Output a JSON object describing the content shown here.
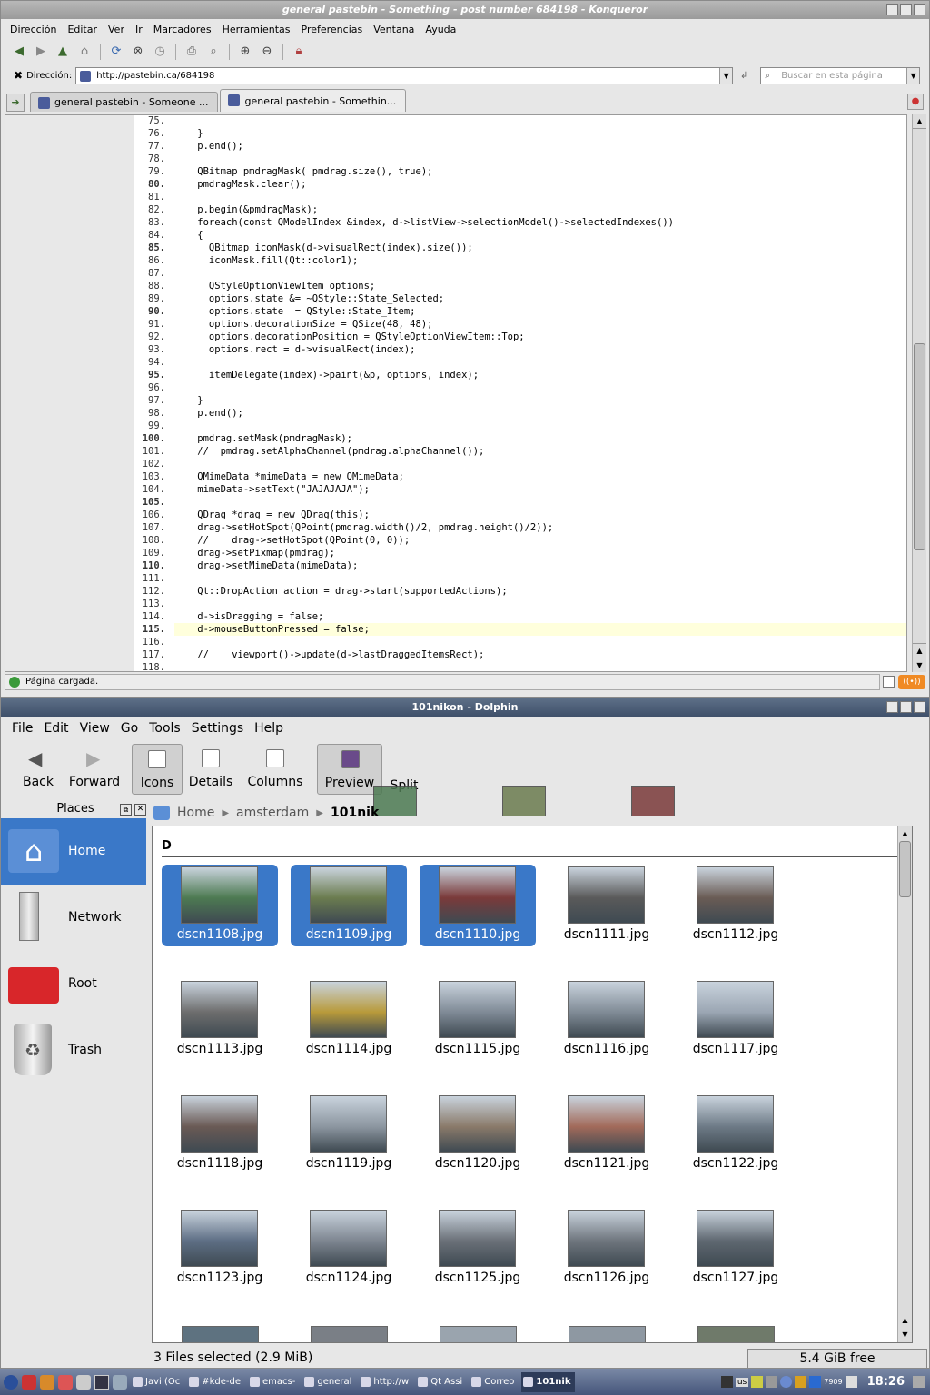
{
  "konqueror": {
    "title": "general pastebin - Something - post number 684198 - Konqueror",
    "menu": [
      "Dirección",
      "Editar",
      "Ver",
      "Ir",
      "Marcadores",
      "Herramientas",
      "Preferencias",
      "Ventana",
      "Ayuda"
    ],
    "address_label": "Dirección:",
    "address": "http://pastebin.ca/684198",
    "search_placeholder": "Buscar en esta página",
    "tabs": [
      {
        "label": "general pastebin - Someone ..."
      },
      {
        "label": "general pastebin - Somethin..."
      }
    ],
    "status": "Página cargada.",
    "code_lines": [
      {
        "n": "75.",
        "t": "",
        "b": false
      },
      {
        "n": "76.",
        "t": "    }",
        "b": false
      },
      {
        "n": "77.",
        "t": "    p.end();",
        "b": false
      },
      {
        "n": "78.",
        "t": "",
        "b": false
      },
      {
        "n": "79.",
        "t": "    QBitmap pmdragMask( pmdrag.size(), true);",
        "b": false
      },
      {
        "n": "80.",
        "t": "    pmdragMask.clear();",
        "b": true
      },
      {
        "n": "81.",
        "t": "",
        "b": false
      },
      {
        "n": "82.",
        "t": "    p.begin(&pmdragMask);",
        "b": false
      },
      {
        "n": "83.",
        "t": "    foreach(const QModelIndex &index, d->listView->selectionModel()->selectedIndexes())",
        "b": false
      },
      {
        "n": "84.",
        "t": "    {",
        "b": false
      },
      {
        "n": "85.",
        "t": "      QBitmap iconMask(d->visualRect(index).size());",
        "b": true
      },
      {
        "n": "86.",
        "t": "      iconMask.fill(Qt::color1);",
        "b": false
      },
      {
        "n": "87.",
        "t": "",
        "b": false
      },
      {
        "n": "88.",
        "t": "      QStyleOptionViewItem options;",
        "b": false
      },
      {
        "n": "89.",
        "t": "      options.state &= ~QStyle::State_Selected;",
        "b": false
      },
      {
        "n": "90.",
        "t": "      options.state |= QStyle::State_Item;",
        "b": true
      },
      {
        "n": "91.",
        "t": "      options.decorationSize = QSize(48, 48);",
        "b": false
      },
      {
        "n": "92.",
        "t": "      options.decorationPosition = QStyleOptionViewItem::Top;",
        "b": false
      },
      {
        "n": "93.",
        "t": "      options.rect = d->visualRect(index);",
        "b": false
      },
      {
        "n": "94.",
        "t": "",
        "b": false
      },
      {
        "n": "95.",
        "t": "      itemDelegate(index)->paint(&p, options, index);",
        "b": true
      },
      {
        "n": "96.",
        "t": "",
        "b": false
      },
      {
        "n": "97.",
        "t": "    }",
        "b": false
      },
      {
        "n": "98.",
        "t": "    p.end();",
        "b": false
      },
      {
        "n": "99.",
        "t": "",
        "b": false
      },
      {
        "n": "100.",
        "t": "    pmdrag.setMask(pmdragMask);",
        "b": true
      },
      {
        "n": "101.",
        "t": "    //  pmdrag.setAlphaChannel(pmdrag.alphaChannel());",
        "b": false
      },
      {
        "n": "102.",
        "t": "",
        "b": false
      },
      {
        "n": "103.",
        "t": "    QMimeData *mimeData = new QMimeData;",
        "b": false
      },
      {
        "n": "104.",
        "t": "    mimeData->setText(\"JAJAJAJA\");",
        "b": false
      },
      {
        "n": "105.",
        "t": "",
        "b": true
      },
      {
        "n": "106.",
        "t": "    QDrag *drag = new QDrag(this);",
        "b": false
      },
      {
        "n": "107.",
        "t": "    drag->setHotSpot(QPoint(pmdrag.width()/2, pmdrag.height()/2));",
        "b": false
      },
      {
        "n": "108.",
        "t": "    //    drag->setHotSpot(QPoint(0, 0));",
        "b": false
      },
      {
        "n": "109.",
        "t": "    drag->setPixmap(pmdrag);",
        "b": false
      },
      {
        "n": "110.",
        "t": "    drag->setMimeData(mimeData);",
        "b": true
      },
      {
        "n": "111.",
        "t": "",
        "b": false
      },
      {
        "n": "112.",
        "t": "    Qt::DropAction action = drag->start(supportedActions);",
        "b": false
      },
      {
        "n": "113.",
        "t": "",
        "b": false
      },
      {
        "n": "114.",
        "t": "    d->isDragging = false;",
        "b": false
      },
      {
        "n": "115.",
        "t": "    d->mouseButtonPressed = false;",
        "b": true,
        "hl": true
      },
      {
        "n": "116.",
        "t": "",
        "b": false
      },
      {
        "n": "117.",
        "t": "    //    viewport()->update(d->lastDraggedItemsRect);",
        "b": false
      },
      {
        "n": "118.",
        "t": "",
        "b": false
      }
    ]
  },
  "dolphin": {
    "title": "101nikon - Dolphin",
    "menu": [
      "File",
      "Edit",
      "View",
      "Go",
      "Tools",
      "Settings",
      "Help"
    ],
    "toolbar": {
      "back": "Back",
      "forward": "Forward",
      "icons": "Icons",
      "details": "Details",
      "columns": "Columns",
      "preview": "Preview",
      "split": "Split"
    },
    "places_title": "Places",
    "places": [
      "Home",
      "Network",
      "Root",
      "Trash"
    ],
    "breadcrumb": [
      "Home",
      "amsterdam",
      "101nik"
    ],
    "group_header": "D",
    "files": [
      {
        "name": "dscn1108.jpg",
        "sel": true,
        "c": "#4d7a52"
      },
      {
        "name": "dscn1109.jpg",
        "sel": true,
        "c": "#6b7c4f"
      },
      {
        "name": "dscn1110.jpg",
        "sel": true,
        "c": "#7a3a3a"
      },
      {
        "name": "dscn1111.jpg",
        "sel": false,
        "c": "#5a5a5a"
      },
      {
        "name": "dscn1112.jpg",
        "sel": false,
        "c": "#6a5c55"
      },
      {
        "name": "dscn1113.jpg",
        "sel": false,
        "c": "#6d6d6d"
      },
      {
        "name": "dscn1114.jpg",
        "sel": false,
        "c": "#b89a3a"
      },
      {
        "name": "dscn1115.jpg",
        "sel": false,
        "c": "#7f8a96"
      },
      {
        "name": "dscn1116.jpg",
        "sel": false,
        "c": "#808b96"
      },
      {
        "name": "dscn1117.jpg",
        "sel": false,
        "c": "#9ba6b3"
      },
      {
        "name": "dscn1118.jpg",
        "sel": false,
        "c": "#6a5a55"
      },
      {
        "name": "dscn1119.jpg",
        "sel": false,
        "c": "#8c96a0"
      },
      {
        "name": "dscn1120.jpg",
        "sel": false,
        "c": "#8a7a6a"
      },
      {
        "name": "dscn1121.jpg",
        "sel": false,
        "c": "#a26a5a"
      },
      {
        "name": "dscn1122.jpg",
        "sel": false,
        "c": "#6d7a86"
      },
      {
        "name": "dscn1123.jpg",
        "sel": false,
        "c": "#5d6e84"
      },
      {
        "name": "dscn1124.jpg",
        "sel": false,
        "c": "#7d8590"
      },
      {
        "name": "dscn1125.jpg",
        "sel": false,
        "c": "#6a7078"
      },
      {
        "name": "dscn1126.jpg",
        "sel": false,
        "c": "#6e757d"
      },
      {
        "name": "dscn1127.jpg",
        "sel": false,
        "c": "#5e6770"
      }
    ],
    "status_left": "3 Files selected (2.9 MiB)",
    "status_right": "5.4 GiB free"
  },
  "taskbar": {
    "tasks": [
      "Javi (Oc",
      "#kde-de",
      "emacs-",
      "general",
      "http://w",
      "Qt Assi",
      "Correo",
      "101nik"
    ],
    "tray_badge": "7909",
    "layout": "us",
    "clock": "18:26"
  },
  "colors": {
    "selection": "#3a78c8",
    "title_active": "#4a5a78"
  }
}
